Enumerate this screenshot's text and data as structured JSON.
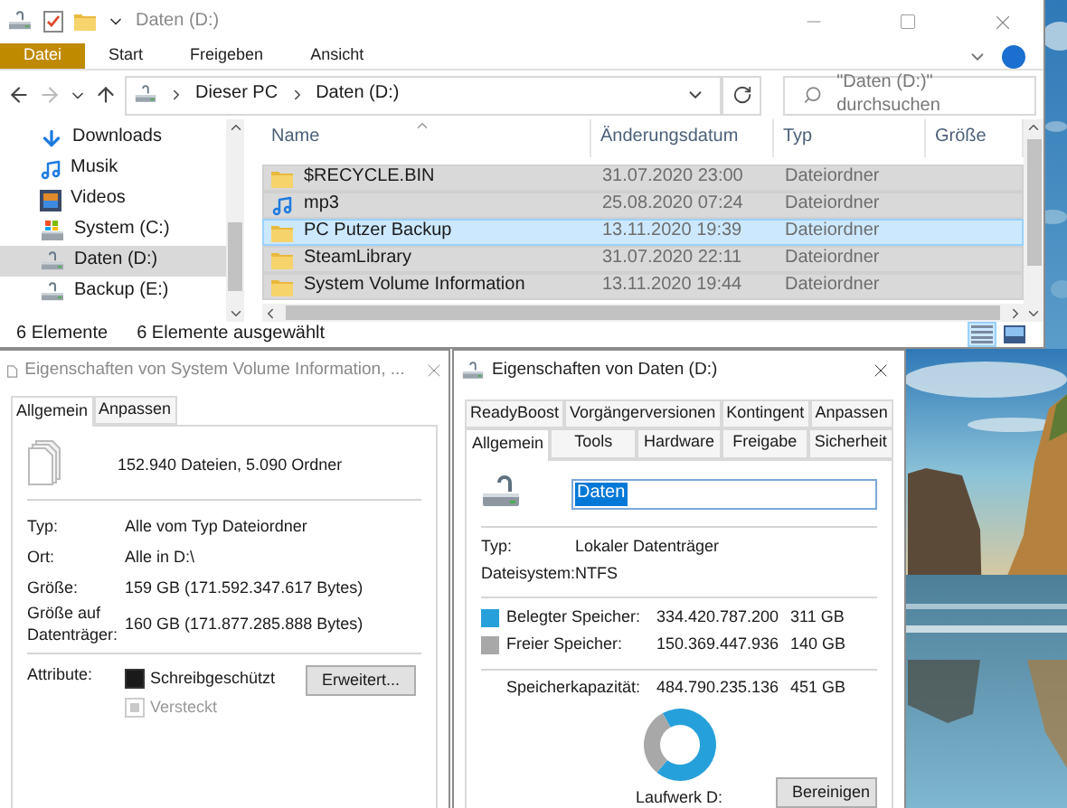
{
  "explorer": {
    "title": "Daten (D:)",
    "ribbon_tabs": [
      {
        "label": "Datei",
        "kind": "file"
      },
      {
        "label": "Start",
        "kind": "tab"
      },
      {
        "label": "Freigeben",
        "kind": "tab"
      },
      {
        "label": "Ansicht",
        "kind": "tab"
      }
    ],
    "path": [
      "Dieser PC",
      "Daten (D:)"
    ],
    "search": {
      "placeholder": "\"Daten (D:)\" durchsuchen"
    },
    "nav_items": [
      {
        "label": "Downloads",
        "kind": "download",
        "selected": false
      },
      {
        "label": "Musik",
        "kind": "music",
        "selected": false
      },
      {
        "label": "Videos",
        "kind": "video",
        "selected": false
      },
      {
        "label": "System (C:)",
        "kind": "system-drive",
        "selected": false
      },
      {
        "label": "Daten (D:)",
        "kind": "drive",
        "selected": true
      },
      {
        "label": "Backup (E:)",
        "kind": "drive",
        "selected": false
      }
    ],
    "columns": [
      "Name",
      "Änderungsdatum",
      "Typ",
      "Größe"
    ],
    "rows": [
      {
        "name": "$RECYCLE.BIN",
        "kind": "folder",
        "date": "31.07.2020 23:00",
        "type": "Dateiordner",
        "selected": true,
        "focused": false
      },
      {
        "name": "mp3",
        "kind": "music",
        "date": "25.08.2020 07:24",
        "type": "Dateiordner",
        "selected": true,
        "focused": false
      },
      {
        "name": "PC Putzer Backup",
        "kind": "folder",
        "date": "13.11.2020 19:39",
        "type": "Dateiordner",
        "selected": true,
        "focused": true
      },
      {
        "name": "SteamLibrary",
        "kind": "folder",
        "date": "31.07.2020 22:11",
        "type": "Dateiordner",
        "selected": true,
        "focused": false
      },
      {
        "name": "System Volume Information",
        "kind": "folder",
        "date": "13.11.2020 19:44",
        "type": "Dateiordner",
        "selected": true,
        "focused": false
      }
    ],
    "status": {
      "count": "6 Elemente",
      "selection": "6 Elemente ausgewählt"
    },
    "views": [
      {
        "kind": "details",
        "selected": true
      },
      {
        "kind": "tiles",
        "selected": false
      }
    ]
  },
  "folder_properties": {
    "title": "Eigenschaften von System Volume Information, ...",
    "tabs": [
      {
        "label": "Allgemein",
        "selected": true
      },
      {
        "label": "Anpassen",
        "selected": false
      }
    ],
    "summary": "152.940 Dateien, 5.090 Ordner",
    "fields": [
      {
        "label": "Typ:",
        "value": "Alle vom Typ Dateiordner"
      },
      {
        "label": "Ort:",
        "value": "Alle in D:\\"
      },
      {
        "label": "Größe:",
        "value": "159 GB (171.592.347.617 Bytes)"
      },
      {
        "label": "Größe auf Datenträger:",
        "value": "160 GB (171.877.285.888 Bytes)"
      }
    ],
    "attributes_label": "Attribute:",
    "attributes": [
      {
        "label": "Schreibgeschützt",
        "indeterminate": true,
        "disabled": false
      },
      {
        "label": "Versteckt",
        "indeterminate": true,
        "disabled": true
      }
    ],
    "button": "Erweitert..."
  },
  "drive_properties": {
    "title": "Eigenschaften von Daten (D:)",
    "tab_rows": [
      {
        "tabs": [
          {
            "label": "ReadyBoost",
            "selected": false
          },
          {
            "label": "Vorgängerversionen",
            "selected": false
          },
          {
            "label": "Kontingent",
            "selected": false
          },
          {
            "label": "Anpassen",
            "selected": false
          }
        ]
      },
      {
        "tabs": [
          {
            "label": "Allgemein",
            "selected": true
          },
          {
            "label": "Tools",
            "selected": false
          },
          {
            "label": "Hardware",
            "selected": false
          },
          {
            "label": "Freigabe",
            "selected": false
          },
          {
            "label": "Sicherheit",
            "selected": false
          }
        ]
      }
    ],
    "name_value": "Daten",
    "fields": [
      {
        "label": "Typ:",
        "value": "Lokaler Datenträger"
      },
      {
        "label": "Dateisystem:",
        "value": "NTFS"
      }
    ],
    "storage": [
      {
        "label": "Belegter Speicher:",
        "bytes": "334.420.787.200",
        "size": "311 GB",
        "color": "#26a0da"
      },
      {
        "label": "Freier Speicher:",
        "bytes": "150.369.447.936",
        "size": "140 GB",
        "color": "#a8a8a8"
      }
    ],
    "capacity": {
      "label": "Speicherkapazität:",
      "bytes": "484.790.235.136",
      "size": "451 GB"
    },
    "chart_data": {
      "type": "donut",
      "series": [
        {
          "values": [
            69,
            31
          ]
        }
      ]
    },
    "drive_label": "Laufwerk D:",
    "button": "Bereinigen"
  }
}
